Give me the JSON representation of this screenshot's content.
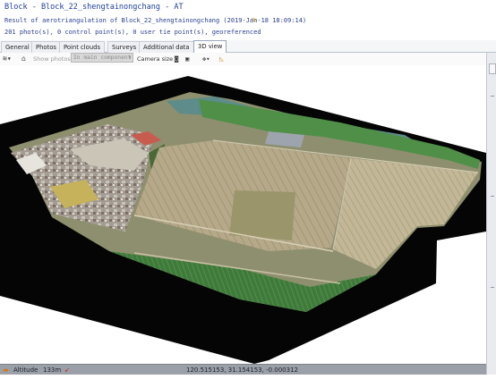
{
  "window": {
    "title": "Block - Block_22_shengtainongchang - AT",
    "info_line1": "Result of aerotriangulation of Block_22_shengtainongchang (2019-Jan-18 18:09:14)",
    "info_line2": "201 photo(s), 0 control point(s), 0 user tie point(s), georeferenced"
  },
  "tabs": [
    "General",
    "Photos",
    "Point clouds",
    "Surveys",
    "Additional data",
    "3D view"
  ],
  "active_tab": "3D view",
  "toolbar": {
    "show_photos_label": "Show photos",
    "component_select": "In main component",
    "camera_size_label": "Camera size"
  },
  "status": {
    "altitude_label": "Altitude",
    "altitude_value": "133m",
    "coordinates": "120.515153, 31.154153, -0.000312"
  },
  "colors": {
    "title_text": "#1e3e9e",
    "accent_pencil": "#d8a21d",
    "status_bar": "#9b9fa8"
  },
  "icons": {
    "edit": "pencil-icon",
    "layers": "layers-icon",
    "home": "home-icon",
    "camera": "camera-icon",
    "north": "north-arrow-icon"
  }
}
